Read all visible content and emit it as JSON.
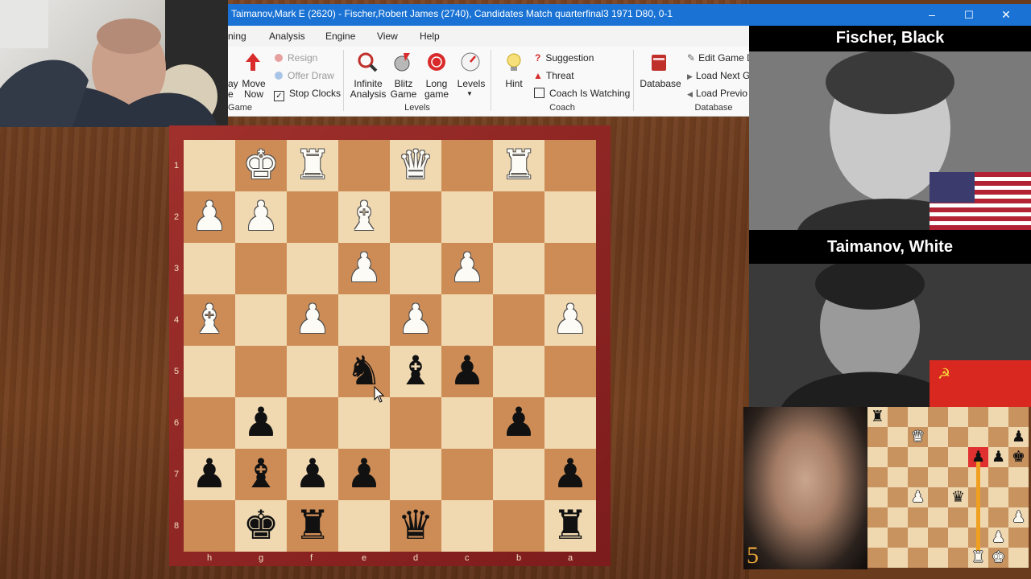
{
  "window": {
    "title": "Taimanov,Mark E (2620) - Fischer,Robert James (2740), Candidates Match quarterfinal3 1971  D80, 0-1",
    "minimize": "–",
    "maximize": "☐",
    "close": "✕"
  },
  "menu": {
    "items": [
      "ning",
      "Analysis",
      "Engine",
      "View",
      "Help"
    ]
  },
  "ribbon": {
    "game_group": {
      "play_label": "ay",
      "play_label2": "e",
      "move_now": "Move Now",
      "resign": "Resign",
      "offer_draw": "Offer Draw",
      "stop_clocks": "Stop Clocks",
      "stop_clocks_checked": true,
      "group_label": "Game"
    },
    "levels_group": {
      "infinite_analysis": "Infinite Analysis",
      "blitz_game": "Blitz Game",
      "long_game": "Long game",
      "levels": "Levels",
      "group_label": "Levels"
    },
    "coach_group": {
      "hint": "Hint",
      "suggestion": "Suggestion",
      "threat": "Threat",
      "coach_watching": "Coach Is Watching",
      "group_label": "Coach"
    },
    "database_group": {
      "database": "Database",
      "edit_game": "Edit Game D",
      "load_next": "Load Next G",
      "load_previous": "Load Previo",
      "group_label": "Database"
    }
  },
  "board": {
    "files": [
      "h",
      "g",
      "f",
      "e",
      "d",
      "c",
      "b",
      "a"
    ],
    "ranks": [
      "1",
      "2",
      "3",
      "4",
      "5",
      "6",
      "7",
      "8"
    ],
    "pieces": [
      {
        "sq": "g1",
        "p": "♚",
        "c": "w"
      },
      {
        "sq": "f1",
        "p": "♜",
        "c": "w"
      },
      {
        "sq": "d1",
        "p": "♛",
        "c": "w"
      },
      {
        "sq": "b1",
        "p": "♜",
        "c": "w"
      },
      {
        "sq": "h2",
        "p": "♟",
        "c": "w"
      },
      {
        "sq": "g2",
        "p": "♟",
        "c": "w"
      },
      {
        "sq": "e2",
        "p": "♝",
        "c": "w"
      },
      {
        "sq": "e3",
        "p": "♟",
        "c": "w"
      },
      {
        "sq": "c3",
        "p": "♟",
        "c": "w"
      },
      {
        "sq": "h4",
        "p": "♝",
        "c": "w"
      },
      {
        "sq": "f4",
        "p": "♟",
        "c": "w"
      },
      {
        "sq": "d4",
        "p": "♟",
        "c": "w"
      },
      {
        "sq": "a4",
        "p": "♟",
        "c": "w"
      },
      {
        "sq": "e5",
        "p": "♞",
        "c": "b"
      },
      {
        "sq": "d5",
        "p": "♝",
        "c": "b"
      },
      {
        "sq": "c5",
        "p": "♟",
        "c": "b"
      },
      {
        "sq": "g6",
        "p": "♟",
        "c": "b"
      },
      {
        "sq": "b6",
        "p": "♟",
        "c": "b"
      },
      {
        "sq": "h7",
        "p": "♟",
        "c": "b"
      },
      {
        "sq": "g7",
        "p": "♝",
        "c": "b"
      },
      {
        "sq": "f7",
        "p": "♟",
        "c": "b"
      },
      {
        "sq": "e7",
        "p": "♟",
        "c": "b"
      },
      {
        "sq": "a7",
        "p": "♟",
        "c": "b"
      },
      {
        "sq": "g8",
        "p": "♚",
        "c": "b"
      },
      {
        "sq": "f8",
        "p": "♜",
        "c": "b"
      },
      {
        "sq": "d8",
        "p": "♛",
        "c": "b"
      },
      {
        "sq": "a8",
        "p": "♜",
        "c": "b"
      }
    ]
  },
  "players": {
    "top_name": "Fischer, Black",
    "bottom_name": "Taimanov, White",
    "move_number": "5"
  },
  "mini_board": {
    "pieces": [
      {
        "r": 0,
        "f": 0,
        "p": "♜",
        "c": "b"
      },
      {
        "r": 1,
        "f": 2,
        "p": "♛",
        "c": "w"
      },
      {
        "r": 1,
        "f": 7,
        "p": "♟",
        "c": "b"
      },
      {
        "r": 2,
        "f": 5,
        "p": "♟",
        "c": "b"
      },
      {
        "r": 2,
        "f": 6,
        "p": "♟",
        "c": "b"
      },
      {
        "r": 2,
        "f": 7,
        "p": "♚",
        "c": "b"
      },
      {
        "r": 4,
        "f": 2,
        "p": "♟",
        "c": "w"
      },
      {
        "r": 4,
        "f": 4,
        "p": "♛",
        "c": "b"
      },
      {
        "r": 5,
        "f": 7,
        "p": "♟",
        "c": "w"
      },
      {
        "r": 6,
        "f": 6,
        "p": "♟",
        "c": "w"
      },
      {
        "r": 7,
        "f": 5,
        "p": "♜",
        "c": "w"
      },
      {
        "r": 7,
        "f": 6,
        "p": "♚",
        "c": "w"
      }
    ]
  },
  "colors": {
    "titlebar": "#1a73d4",
    "board_light": "#f0d9b1",
    "board_dark": "#cd8c56",
    "frame": "#8e2424",
    "highlight": "#e03030",
    "arrow": "#f0a020"
  }
}
